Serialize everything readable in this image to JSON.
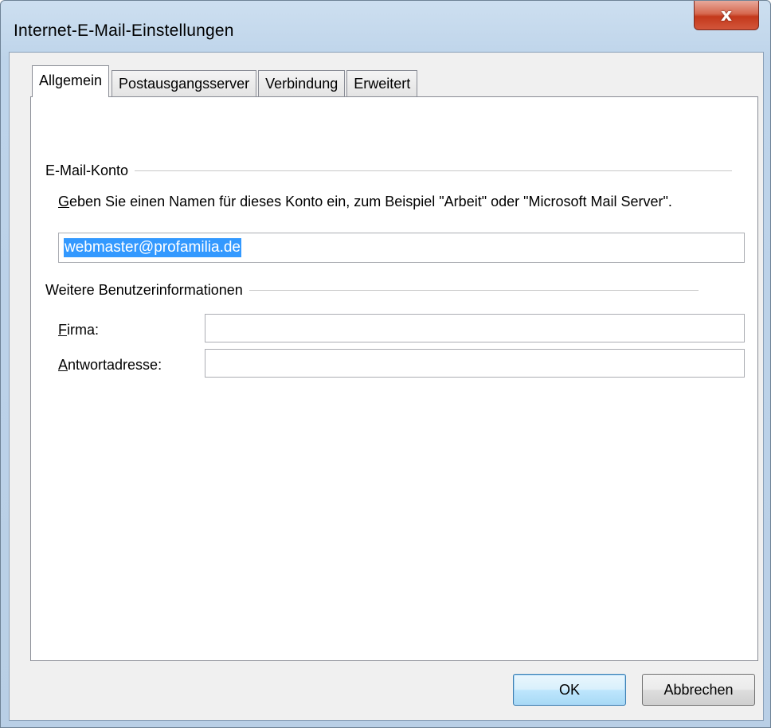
{
  "window": {
    "title": "Internet-E-Mail-Einstellungen",
    "close_label": "x"
  },
  "tabs": [
    {
      "label": "Allgemein",
      "active": true
    },
    {
      "label": "Postausgangsserver",
      "active": false
    },
    {
      "label": "Verbindung",
      "active": false
    },
    {
      "label": "Erweitert",
      "active": false
    }
  ],
  "account_group": {
    "heading": "E-Mail-Konto",
    "description_mnemonic": "G",
    "description_rest": "eben Sie einen Namen für dieses Konto ein, zum Beispiel \"Arbeit\" oder \"Microsoft Mail Server\".",
    "account_name_value": "webmaster@profamilia.de"
  },
  "user_info_group": {
    "heading": "Weitere Benutzerinformationen",
    "company_label_mnemonic": "F",
    "company_label_rest": "irma:",
    "company_value": "",
    "reply_label_mnemonic": "A",
    "reply_label_rest": "ntwortadresse:",
    "reply_value": ""
  },
  "buttons": {
    "ok": "OK",
    "cancel": "Abbrechen"
  },
  "colors": {
    "selection": "#3399ff",
    "close_button": "#c4391c",
    "frame": "#bed4ea"
  }
}
